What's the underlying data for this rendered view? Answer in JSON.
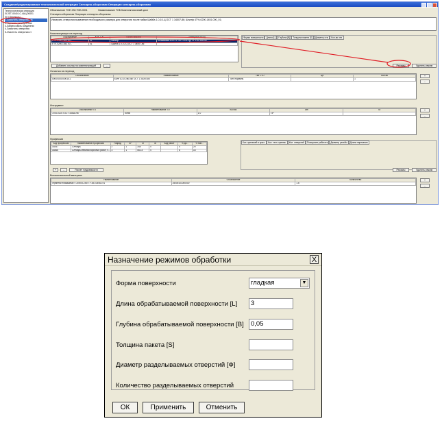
{
  "main_window": {
    "title": "Создание\\редактирование технологической операции Слесарно-сборочная Операция слесарно-сборочная",
    "tree": [
      {
        "label": "Технологическая операция"
      },
      {
        "label": "⊟ 2ЕТ-0040.1С.4АЦ.00001"
      },
      {
        "label": "   ⊟ 0 Переходы"
      },
      {
        "label": "      1-Зачистить отверстия на",
        "selected": true
      },
      {
        "label": "      2-Нарезать резьбу в отве"
      },
      {
        "label": "      3-Запрессовать соединени"
      },
      {
        "label": "      4-Зачистить отверстия"
      },
      {
        "label": "      5-Очистить отверстия от"
      }
    ],
    "header": {
      "designation": "Обозначение ТОЕ 230.ТОБ.0001",
      "name": "Наименование ТОБ Комплектовочный цикл",
      "operation": "Слесарно-сборочная Операция слесарно-сборочная",
      "text": "Измерить отверстия выявление необходимого размера для отверстия после пайки Шайба 1.0-10-Ц ОСТ 1 34507-86; Шпатф 4T%-0200.1451.000_01;"
    },
    "assembly_units": {
      "label": "Комплектующие на переход",
      "columns": [
        "Обозначение",
        "Кол-ТОБ",
        "Наименование",
        "Материал на ИД"
      ],
      "rows": [
        [
          "ETV-0200.1451.00...",
          "01",
          "Шпатф",
          "Штамповка И.ЕО.1 ЭОТ-21А-ОД ТУ 1-92-158-90"
        ],
        [
          "ETV-0200.1451.00...",
          "01",
          "Шайба 1.0-10-Ц ОСТ 1 34507-86",
          ""
        ]
      ],
      "add_button": "Добавить ссылку на комплектующий",
      "dash_button": "..."
    },
    "mode_tabs": [
      "Форма поверхности",
      "Длина [L]",
      "Глубина [B]",
      "Толщина пакета [S]",
      "Диаметр отв.",
      "Кол-во отв."
    ],
    "modes_button": "Режимы",
    "delete_mode_button": "Удалить режим",
    "tooling": {
      "label": "Оснастка на переход",
      "columns": [
        "Обозначение",
        "Наименование",
        "Тип СТО",
        "ЦН",
        "Кол-во"
      ],
      "rows": [
        [
          "0000001000001/11",
          "Болт 10-24-4в.Окс ОСТ 1 31000-86",
          "Тип: нормаль",
          "",
          "1"
        ]
      ]
    },
    "instruments": {
      "label": "Инструмент",
      "columns": [
        "Обозначение ТО",
        "Наименование ТО",
        "Кол-во",
        "Тип",
        "Та"
      ],
      "rows": [
        [
          "7100-0201 ГОСТ 16518-96",
          "Ключ",
          "1,0",
          "ПР",
          ""
        ]
      ]
    },
    "professions": {
      "label": "Профессии",
      "columns": [
        "Код профессии",
        "Наименование профессии",
        "Разряд",
        "КР",
        "Тп",
        "Тв",
        "Код работ",
        "% до...",
        "% пов..."
      ],
      "rows": [
        [
          "18447",
          "Слесарь",
          "2",
          "1",
          "340",
          "0",
          "",
          "4",
          "20"
        ],
        [
          "18466",
          "Слесарь механосборочных работ, ч...",
          "3",
          "1",
          "56.14",
          "0",
          "",
          "8",
          "16"
        ]
      ],
      "hole_tabs": [
        "Кол. крепежей в крыл.",
        "Кол. техн. крепеж.",
        "Кол. отверстий",
        "Позиционн.работать",
        "Диаметр резьбы",
        "Длина нарезания"
      ],
      "plus_button": "+",
      "dash_button": "...",
      "labor_button": "Расчет трудоемкости"
    },
    "aux_material": {
      "label": "Вспомогательный материал",
      "columns": [
        "Наименование",
        "Обозначение",
        "Количество"
      ],
      "rows": [
        [
          "Герметик плакашный У-30МЭС-5М ТУ 38.105462-91",
          "25005101000000",
          "1.6"
        ]
      ]
    },
    "small_buttons": {
      "plus": "+",
      "dash": "..."
    }
  },
  "dialog": {
    "title": "Назначение режимов обработки",
    "close": "X",
    "fields": [
      {
        "label": "Форма поверхности",
        "type": "combo",
        "value": "гладкая"
      },
      {
        "label": "Длина обрабатываемой поверхности [L]",
        "type": "text",
        "value": "3"
      },
      {
        "label": "Глубина обрабатываемой поверхности [B]",
        "type": "text",
        "value": "0,05"
      },
      {
        "label": "Толщина пакета [S]",
        "type": "text",
        "value": ""
      },
      {
        "label": "Диаметр разделываемых отверстий [Ф]",
        "type": "text",
        "value": ""
      },
      {
        "label": "Количество разделываемых отверстий",
        "type": "text",
        "value": ""
      }
    ],
    "buttons": {
      "ok": "ОК",
      "apply": "Применить",
      "cancel": "Отменить"
    }
  },
  "colors": {
    "selection": "#316ac5",
    "highlight_circle": "#e01b24",
    "dialog_bg": "#ece9d8"
  }
}
